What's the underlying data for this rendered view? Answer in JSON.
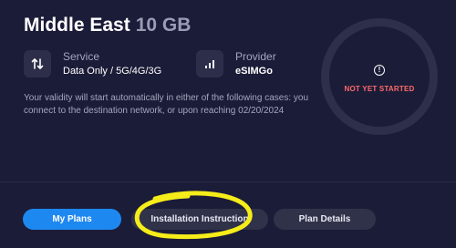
{
  "header": {
    "title": "Middle East",
    "data_size": "10 GB"
  },
  "service": {
    "label": "Service",
    "value": "Data Only / 5G/4G/3G",
    "icon": "up-down-arrows-icon"
  },
  "provider": {
    "label": "Provider",
    "value": "eSIMGo",
    "icon": "signal-bars-icon"
  },
  "validity_text": "Your validity will start automatically in either of the following cases: you connect to the destination network, or upon reaching 02/20/2024",
  "status": {
    "text": "NOT YET STARTED",
    "icon": "alert-circle-icon",
    "color": "#ff6a6a"
  },
  "tabs": [
    {
      "label": "My Plans",
      "active": true
    },
    {
      "label": "Installation Instruction",
      "active": false
    },
    {
      "label": "Plan Details",
      "active": false
    }
  ],
  "colors": {
    "background": "#1b1c38",
    "accent": "#1e88f1",
    "highlight": "#f5ec1a"
  }
}
